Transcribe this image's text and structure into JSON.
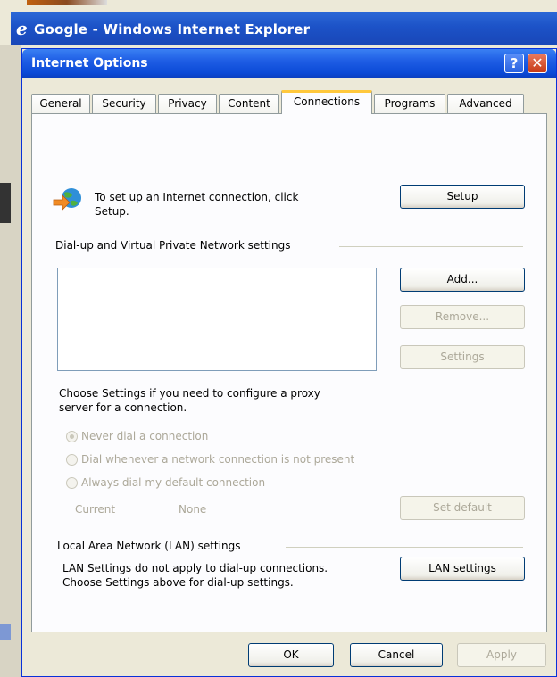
{
  "browser": {
    "title": "Google - Windows Internet Explorer",
    "logo_glyph": "e"
  },
  "dialog": {
    "title": "Internet Options",
    "help_label": "?",
    "close_label": "✕"
  },
  "tabs": [
    {
      "label": "General"
    },
    {
      "label": "Security"
    },
    {
      "label": "Privacy"
    },
    {
      "label": "Content"
    },
    {
      "label": "Connections"
    },
    {
      "label": "Programs"
    },
    {
      "label": "Advanced"
    }
  ],
  "setup": {
    "text_line1": "To set up an Internet connection, click",
    "text_line2": "Setup.",
    "button": "Setup"
  },
  "dialup": {
    "heading": "Dial-up and Virtual Private Network settings",
    "add_button": "Add...",
    "remove_button": "Remove...",
    "settings_button": "Settings",
    "proxy_note_line1": "Choose Settings if you need to configure a proxy",
    "proxy_note_line2": "server for a connection.",
    "options": [
      {
        "label": "Never dial a connection",
        "selected": true
      },
      {
        "label": "Dial whenever a network connection is not present",
        "selected": false
      },
      {
        "label": "Always dial my default connection",
        "selected": false
      }
    ],
    "current_label": "Current",
    "current_value": "None",
    "set_default_button": "Set default"
  },
  "lan": {
    "heading": "Local Area Network (LAN) settings",
    "note_line1": "LAN Settings do not apply to dial-up connections.",
    "note_line2": "Choose Settings above for dial-up settings.",
    "button": "LAN settings"
  },
  "footer": {
    "ok": "OK",
    "cancel": "Cancel",
    "apply": "Apply"
  },
  "colors": {
    "titlebar": "#1f5ee5",
    "dialog_bg": "#ece9d8",
    "button_border": "#003c74",
    "disabled_text": "#aca899",
    "active_tab_accent": "#ffc83c"
  }
}
